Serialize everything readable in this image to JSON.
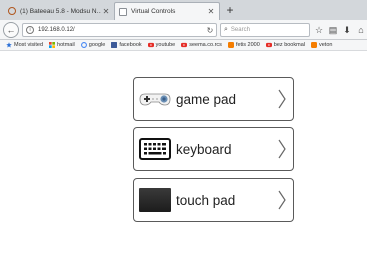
{
  "browser": {
    "tabs": [
      {
        "title": "(1) Bateeau 5.8 - Modsu N...",
        "active": false
      },
      {
        "title": "Virtual Controls",
        "active": true
      }
    ],
    "new_tab_symbol": "+",
    "url": "192.168.0.12/",
    "search_placeholder": "Search",
    "bookmarks": [
      {
        "label": "Most visited",
        "icon": "star-icon",
        "color": "#2a6fd6"
      },
      {
        "label": "hotmail",
        "icon": "windows-icon",
        "color": "#e6462c"
      },
      {
        "label": "google",
        "icon": "google-icon",
        "color": "#4285f4"
      },
      {
        "label": "facebook",
        "icon": "facebook-icon",
        "color": "#3b5998"
      },
      {
        "label": "youtube",
        "icon": "youtube-icon",
        "color": "#e52d27"
      },
      {
        "label": "seema.co.rcs",
        "icon": "youtube-icon",
        "color": "#e52d27"
      },
      {
        "label": "fetis 2000",
        "icon": "blogger-icon",
        "color": "#f57d00"
      },
      {
        "label": "bez bookmal",
        "icon": "youtube-icon",
        "color": "#e52d27"
      },
      {
        "label": "veton",
        "icon": "blogger-icon",
        "color": "#f57d00"
      }
    ]
  },
  "menu": {
    "items": [
      {
        "label": "game pad",
        "thumbnail": "gamepad-icon"
      },
      {
        "label": "keyboard",
        "thumbnail": "keyboard-icon"
      },
      {
        "label": "touch pad",
        "thumbnail": "touchpad-icon"
      }
    ]
  }
}
